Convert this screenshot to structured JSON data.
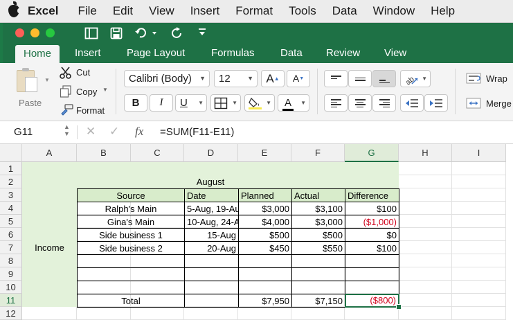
{
  "menubar": {
    "app": "Excel",
    "items": [
      "File",
      "Edit",
      "View",
      "Insert",
      "Format",
      "Tools",
      "Data",
      "Window",
      "Help"
    ]
  },
  "ribbon_tabs": [
    "Home",
    "Insert",
    "Page Layout",
    "Formulas",
    "Data",
    "Review",
    "View"
  ],
  "active_tab": "Home",
  "clipboard": {
    "paste": "Paste",
    "cut": "Cut",
    "copy": "Copy",
    "format": "Format"
  },
  "font": {
    "name": "Calibri (Body)",
    "size": "12",
    "grow": "A",
    "shrink": "A",
    "bold": "B",
    "italic": "I",
    "underline": "U",
    "font_color": "A"
  },
  "alignment": {
    "wrap": "Wrap",
    "merge": "Merge"
  },
  "formula_bar": {
    "cell_ref": "G11",
    "fx": "fx",
    "formula": "=SUM(F11-E11)"
  },
  "colors": {
    "excel_green": "#1e7145",
    "negative_red": "#d0021b",
    "header_fill": "#d8eccb",
    "label_fill": "#e3f2da"
  },
  "sheet": {
    "columns": [
      "A",
      "B",
      "C",
      "D",
      "E",
      "F",
      "G",
      "H",
      "I"
    ],
    "rows": [
      "1",
      "2",
      "3",
      "4",
      "5",
      "6",
      "7",
      "8",
      "9",
      "10",
      "11",
      "12"
    ],
    "selected_col": "G",
    "selected_row": "11",
    "month": "August",
    "category": "Income",
    "headers": {
      "source": "Source",
      "date": "Date",
      "planned": "Planned",
      "actual": "Actual",
      "difference": "Difference"
    },
    "data_rows": [
      {
        "source": "Ralph's Main",
        "date": "5-Aug, 19-Au",
        "planned": "$3,000",
        "actual": "$3,100",
        "difference": "$100",
        "negative": false
      },
      {
        "source": "Gina's Main",
        "date": "10-Aug, 24-A",
        "planned": "$4,000",
        "actual": "$3,000",
        "difference": "($1,000)",
        "negative": true
      },
      {
        "source": "Side business 1",
        "date": "15-Aug",
        "planned": "$500",
        "actual": "$500",
        "difference": "$0",
        "negative": false
      },
      {
        "source": "Side business 2",
        "date": "20-Aug",
        "planned": "$450",
        "actual": "$550",
        "difference": "$100",
        "negative": false
      }
    ],
    "total": {
      "label": "Total",
      "planned": "$7,950",
      "actual": "$7,150",
      "difference": "($800)"
    }
  }
}
